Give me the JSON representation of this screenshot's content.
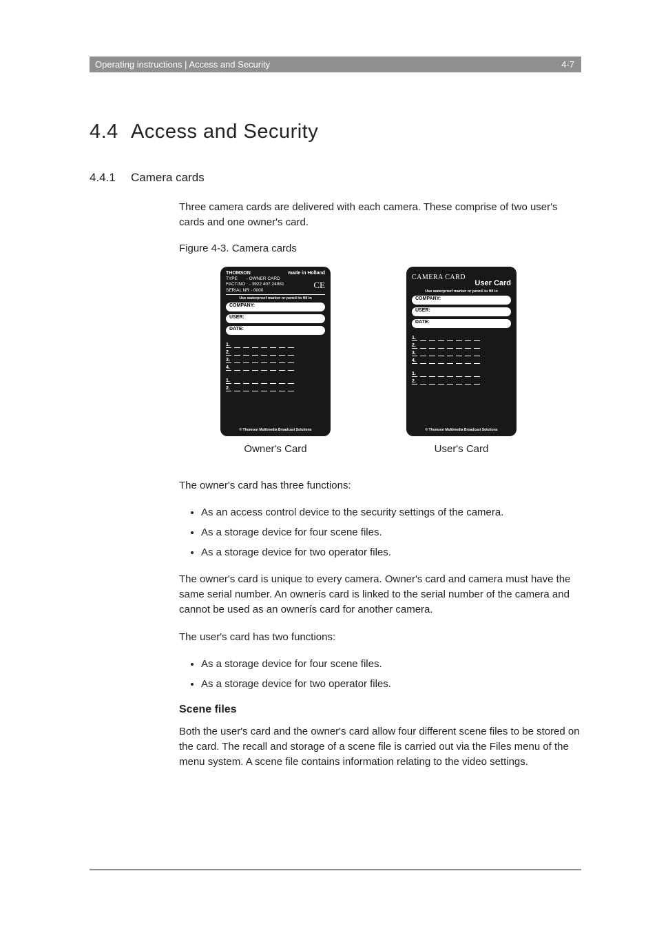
{
  "header": {
    "left": "Operating instructions | Access and Security",
    "right": "4-7"
  },
  "h1": {
    "num": "4.4",
    "title": "Access and Security"
  },
  "h2": {
    "num": "4.4.1",
    "title": "Camera cards"
  },
  "intro_para": "Three camera cards are delivered with each camera. These comprise of two user's cards and one owner's card.",
  "figure": {
    "caption": "Figure 4-3.  Camera cards"
  },
  "owner_card": {
    "brand": "THOMSON",
    "made_in": "made in Holland",
    "type_label": "TYPE",
    "type_value": "- OWNER CARD",
    "factno_label": "FACT/NO",
    "factno_value": "- 3922 407 24981",
    "serial_label": "SERIAL NR",
    "serial_value": "- 0000",
    "ce": "CE",
    "hint": "Use waterproof marker or pencil to fill in",
    "company_label": "COMPANY:",
    "user_label": "USER:",
    "date_label": "DATE:",
    "lines4": [
      "1.",
      "2.",
      "3.",
      "4."
    ],
    "lines2": [
      "1.",
      "2."
    ],
    "copyright": "© Thomson Multimedia Broadcast Solutions",
    "caption": "Owner's Card"
  },
  "user_card": {
    "title_cursive": "CAMERA CARD",
    "title_block": "User Card",
    "hint": "Use waterproof marker or pencil to fill in",
    "company_label": "COMPANY:",
    "user_label": "USER:",
    "date_label": "DATE:",
    "lines4": [
      "1.",
      "2.",
      "3.",
      "4."
    ],
    "lines2": [
      "1.",
      "2."
    ],
    "copyright": "© Thomson Multimedia Broadcast Solutions",
    "caption": "User's Card"
  },
  "owner_functions_intro": "The owner's card has three functions:",
  "owner_functions": [
    "As an access control device to the security settings of the camera.",
    "As a storage device for four scene files.",
    "As a storage device for two operator files."
  ],
  "owner_para": "The owner's card is unique to every camera. Owner's card and camera must have the same serial number. An ownerís card is linked to the serial number of the camera and cannot be used as an ownerís card for another camera.",
  "user_functions_intro": "The user's card has two functions:",
  "user_functions": [
    "As a storage device for four scene files.",
    "As a storage device for two operator files."
  ],
  "scene_head": "Scene files",
  "scene_para": "Both the user's card and the owner's card allow four different scene files to be stored on the card. The recall and storage of a scene file is carried out via the Files menu of the menu system. A scene file contains information relating to the video settings."
}
